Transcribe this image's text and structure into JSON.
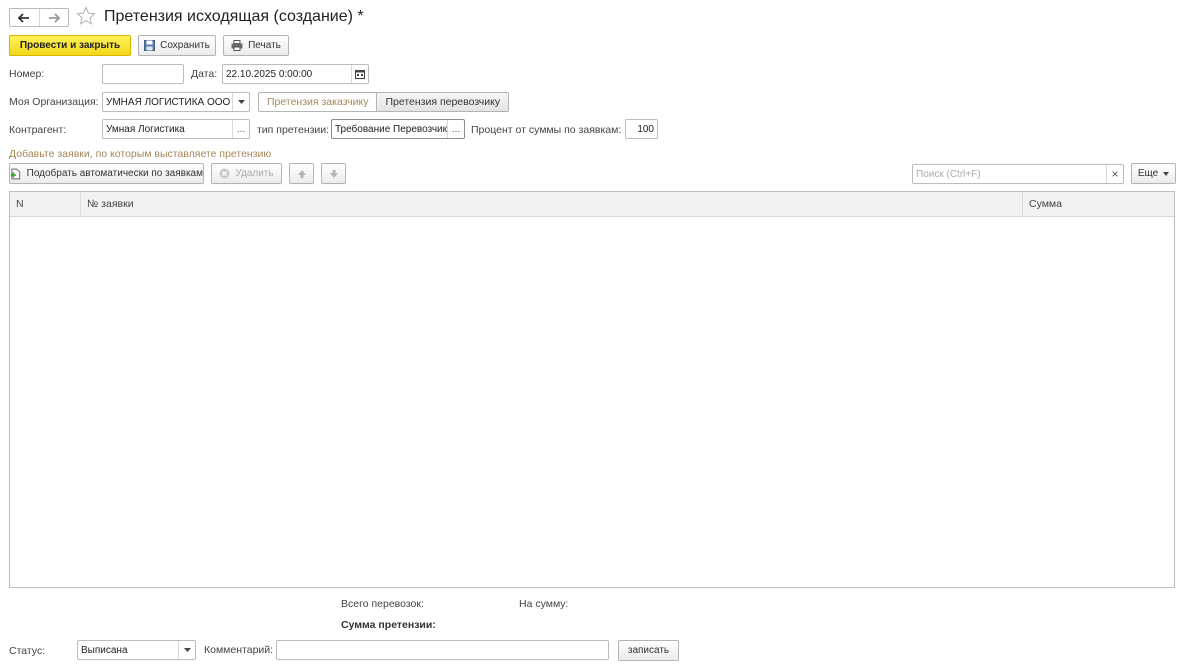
{
  "window": {
    "title": "Претензия исходящая (создание) *"
  },
  "toolbar": {
    "post_close_label": "Провести и закрыть",
    "save_label": "Сохранить",
    "print_label": "Печать"
  },
  "form": {
    "number_label": "Номер:",
    "number_value": "",
    "date_label": "Дата:",
    "date_value": "22.10.2025  0:00:00",
    "org_label": "Моя Организация:",
    "org_value": "УМНАЯ ЛОГИСТИКА ООО",
    "tabs": [
      {
        "label": "Претензия заказчику",
        "active": false
      },
      {
        "label": "Претензия перевозчику",
        "active": true
      }
    ],
    "contractor_label": "Контрагент:",
    "contractor_value": "Умная Логистика",
    "claim_type_label": "тип претензии:",
    "claim_type_value": "Требование Перевозчику",
    "percent_label": "Процент от суммы по заявкам:",
    "percent_value": "100",
    "ellipsis": "..."
  },
  "requests": {
    "hint": "Добавьте заявки, по которым выставляете претензию",
    "auto_pick_label": "Подобрать автоматически по заявкам",
    "delete_label": "Удалить",
    "search_placeholder": "Поиск (Ctrl+F)",
    "clear_symbol": "×",
    "more_label": "Еще",
    "columns": [
      "N",
      "№ заявки",
      "Сумма"
    ],
    "rows": []
  },
  "totals": {
    "total_shipments_label": "Всего перевозок:",
    "total_sum_label": "На сумму:",
    "claim_sum_label": "Сумма претензии:"
  },
  "bottom": {
    "status_label": "Статус:",
    "status_value": "Выписана",
    "comment_label": "Комментарий:",
    "comment_value": "",
    "write_label": "записать"
  },
  "colors": {
    "primary_button": "#f3d81a",
    "hint_text": "#a5875a",
    "border": "#bcbcbc"
  }
}
